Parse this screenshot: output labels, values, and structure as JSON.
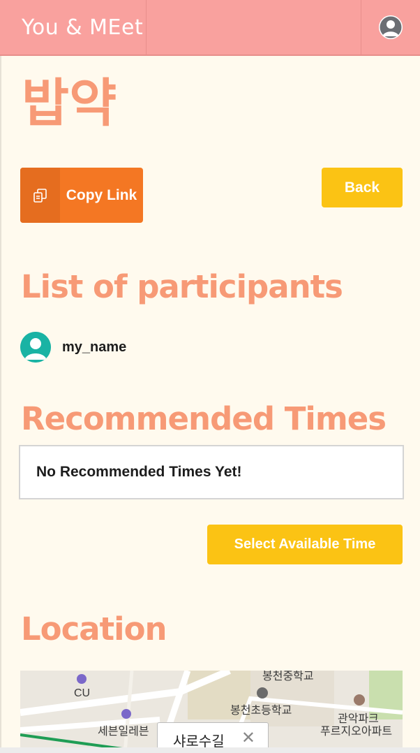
{
  "navbar": {
    "brand": "You & MEet",
    "user_icon": "user-avatar-icon"
  },
  "page": {
    "title": "밥약"
  },
  "actions": {
    "copy_link_label": "Copy Link",
    "copy_icon": "copy-icon",
    "back_label": "Back"
  },
  "participants": {
    "heading": "List of participants",
    "items": [
      {
        "name": "my_name",
        "icon": "user-avatar-icon"
      }
    ]
  },
  "recommended": {
    "heading": "Recommended Times",
    "empty_message": "No Recommended Times Yet!",
    "select_button": "Select Available Time"
  },
  "location": {
    "heading": "Location",
    "map_labels": [
      "봉천중학교",
      "CU",
      "봉천초등학교",
      "세븐일레븐",
      "관악파크",
      "푸르지오아파트"
    ],
    "popup_text": "샤로수길",
    "popup_close": "✕"
  },
  "colors": {
    "navbar": "#f9a19e",
    "heading": "#f79a76",
    "orange_button": "#f47723",
    "yellow_button": "#fbc314",
    "background": "#fffaee",
    "participant_avatar": "#19b3a4"
  }
}
